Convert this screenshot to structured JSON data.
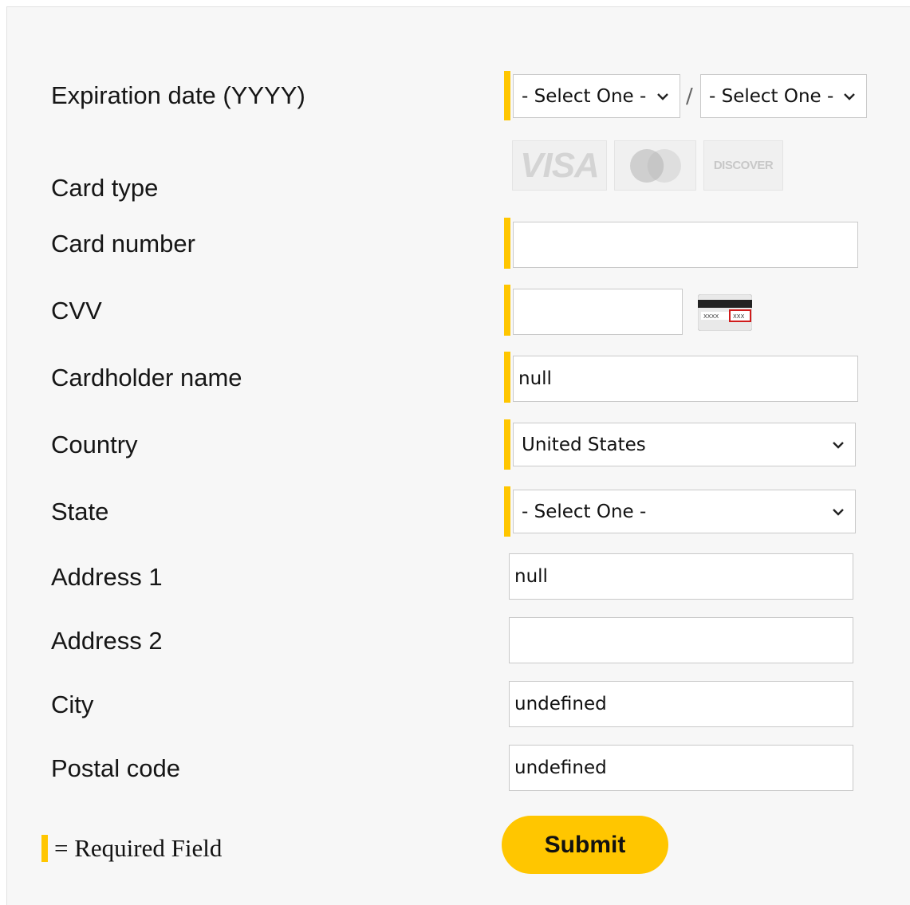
{
  "labels": {
    "expiration": "Expiration date (YYYY)",
    "card_type": "Card type",
    "card_number": "Card number",
    "cvv": "CVV",
    "cardholder": "Cardholder name",
    "country": "Country",
    "state": "State",
    "address1": "Address 1",
    "address2": "Address 2",
    "city": "City",
    "postal": "Postal code"
  },
  "expiration": {
    "month_value": "- Select One -",
    "separator": "/",
    "year_value": "- Select One -"
  },
  "card_types": {
    "visa": "VISA",
    "discover": "DISCOVER",
    "mastercard_icon": "mastercard-logo-icon"
  },
  "fields": {
    "card_number": "",
    "cvv": "",
    "cardholder": "null",
    "country": "United States",
    "state": "- Select One -",
    "address1": "null",
    "address2": "",
    "city": "undefined",
    "postal": "undefined"
  },
  "cvv_icon": "card-back-cvv-icon",
  "submit_label": "Submit",
  "legend": "= Required Field",
  "colors": {
    "required_marker": "#ffc600",
    "submit_bg": "#ffc600",
    "panel_bg": "#f7f7f7"
  }
}
